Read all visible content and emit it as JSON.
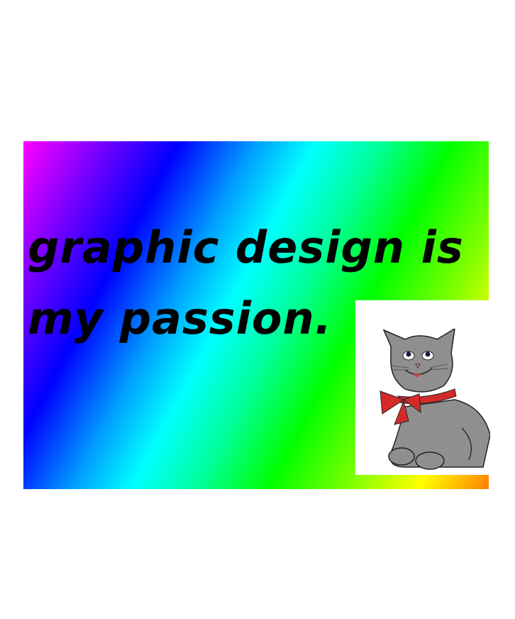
{
  "meme": {
    "caption_line1": "graphic design is",
    "caption_line2": "my passion.",
    "colors": {
      "gradient": [
        "#ff00ff",
        "#0000ff",
        "#00ffff",
        "#00ff00",
        "#ffff00",
        "#ff8000"
      ],
      "cat": "#8f8f8f",
      "bow": "#d42a2a"
    },
    "image": "cat-clipart"
  }
}
